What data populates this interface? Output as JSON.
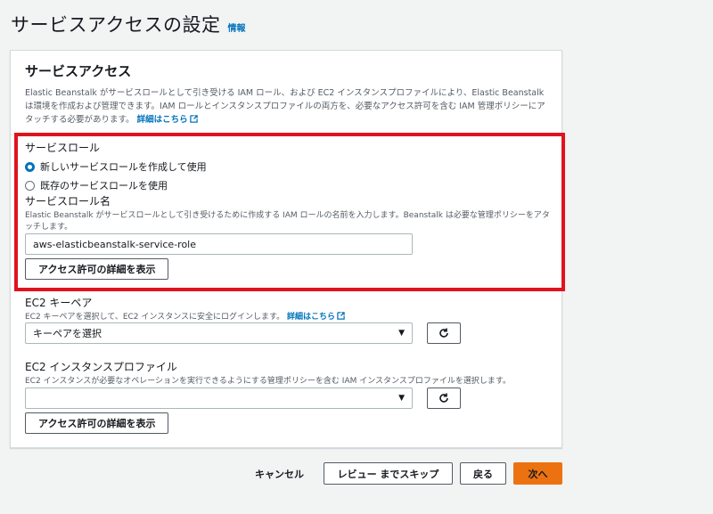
{
  "page": {
    "title": "サービスアクセスの設定",
    "info": "情報"
  },
  "panel": {
    "title": "サービスアクセス",
    "desc_1": "Elastic Beanstalk がサービスロールとして引き受ける IAM ロール、および EC2 インスタンスプロファイルにより、Elastic Beanstalk は環境を作成および管理できます。IAM ロールとインスタンスプロファイルの両方を、必要なアクセス許可を含む IAM 管理ポリシーにアタッチする必要があります。",
    "learn_more": "詳細はこちら"
  },
  "service_role": {
    "label": "サービスロール",
    "option_new": "新しいサービスロールを作成して使用",
    "option_existing": "既存のサービスロールを使用",
    "name_label": "サービスロール名",
    "name_desc": "Elastic Beanstalk がサービスロールとして引き受けるために作成する IAM ロールの名前を入力します。Beanstalk は必要な管理ポリシーをアタッチします。",
    "name_value": "aws-elasticbeanstalk-service-role",
    "details_button": "アクセス許可の詳細を表示"
  },
  "keypair": {
    "label": "EC2 キーペア",
    "desc": "EC2 キーペアを選択して、EC2 インスタンスに安全にログインします。",
    "learn_more": "詳細はこちら",
    "placeholder": "キーペアを選択"
  },
  "instance_profile": {
    "label": "EC2 インスタンスプロファイル",
    "desc": "EC2 インスタンスが必要なオペレーションを実行できるようにする管理ポリシーを含む IAM インスタンスプロファイルを選択します。",
    "value": "",
    "details_button": "アクセス許可の詳細を表示"
  },
  "footer": {
    "cancel": "キャンセル",
    "skip": "レビュー までスキップ",
    "back": "戻る",
    "next": "次へ"
  },
  "colors": {
    "accent": "#0073bb",
    "primary": "#ec7211",
    "highlight": "#e0131f"
  }
}
